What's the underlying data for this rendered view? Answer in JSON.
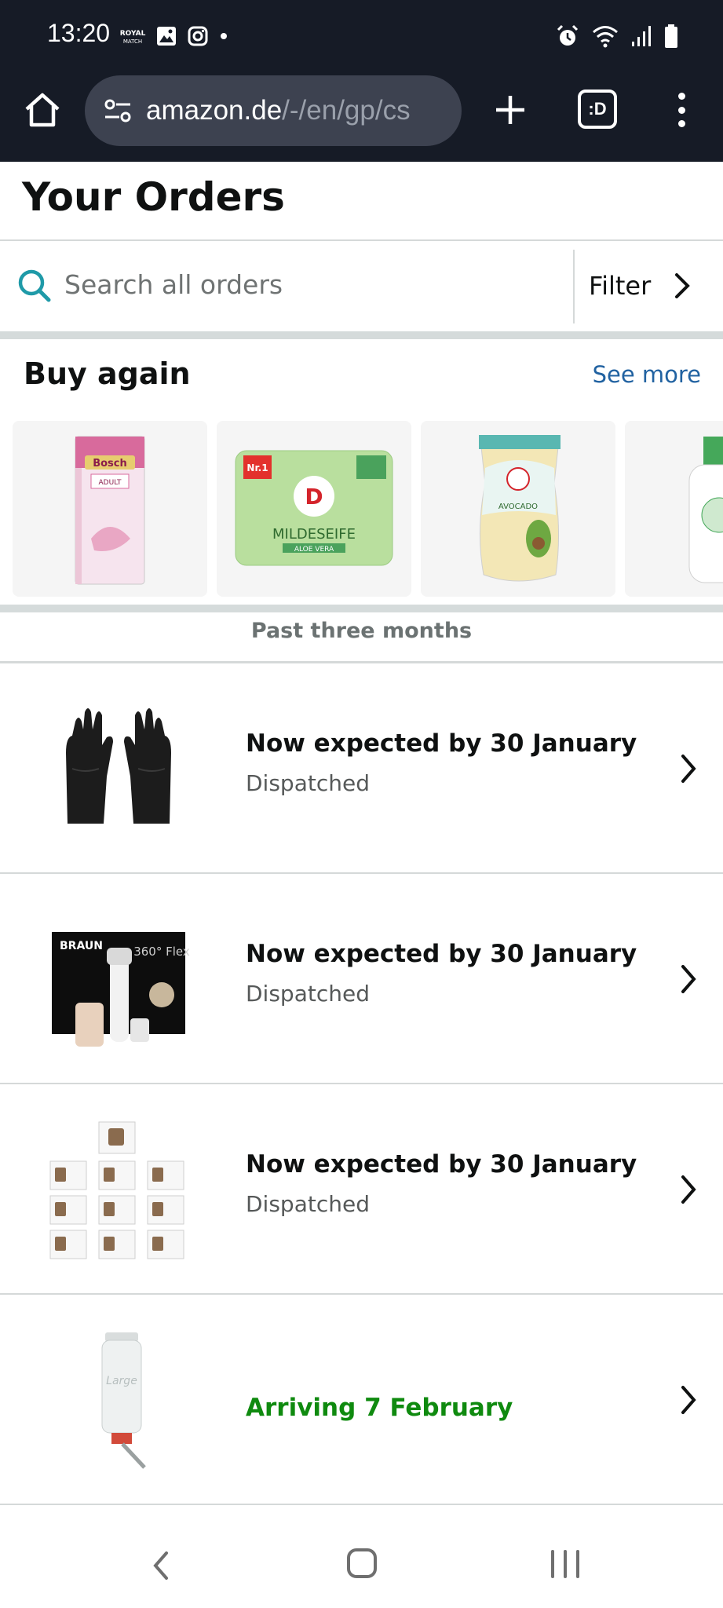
{
  "status_bar": {
    "time": "13:20",
    "notification_icons": [
      "royal-match-icon",
      "gallery-icon",
      "instagram-icon",
      "dot-icon"
    ],
    "system_icons": [
      "alarm-icon",
      "wifi-icon",
      "signal-icon",
      "battery-icon"
    ]
  },
  "browser": {
    "url_domain": "amazon.de",
    "url_path": "/-/en/gp/cs",
    "tab_badge": ":D",
    "background_color": "#161b26"
  },
  "page": {
    "title": "Your Orders"
  },
  "search": {
    "placeholder": "Search all orders",
    "filter_label": "Filter"
  },
  "buy_again": {
    "title": "Buy again",
    "see_more": "See more",
    "items": [
      {
        "name": "bosch-cat-food-product",
        "label": "Bosch",
        "sub": "ADULT"
      },
      {
        "name": "milde-seife-soap-product",
        "label": "MILDESEIFE",
        "sub": "ALOE VERA",
        "badge": "Nr.1"
      },
      {
        "name": "avocado-refill-product",
        "label": "AVOCADO"
      },
      {
        "name": "bottle-product"
      }
    ]
  },
  "section": {
    "label": "Past three months"
  },
  "orders": [
    {
      "status": "Now expected by 30 January",
      "substatus": "Dispatched",
      "thumb": "gloves"
    },
    {
      "status": "Now expected by 30 January",
      "substatus": "Dispatched",
      "thumb": "braun-epilator",
      "brand": "BRAUN",
      "model": "360° Flex"
    },
    {
      "status": "Now expected by 30 January",
      "substatus": "Dispatched",
      "thumb": "vacuum-bags"
    },
    {
      "status": "Arriving 7 February",
      "substatus": "",
      "thumb": "water-bottle"
    }
  ],
  "colors": {
    "link": "#2162a1",
    "arriving_green": "#0f8a0f",
    "search_icon": "#1f9aa8"
  }
}
